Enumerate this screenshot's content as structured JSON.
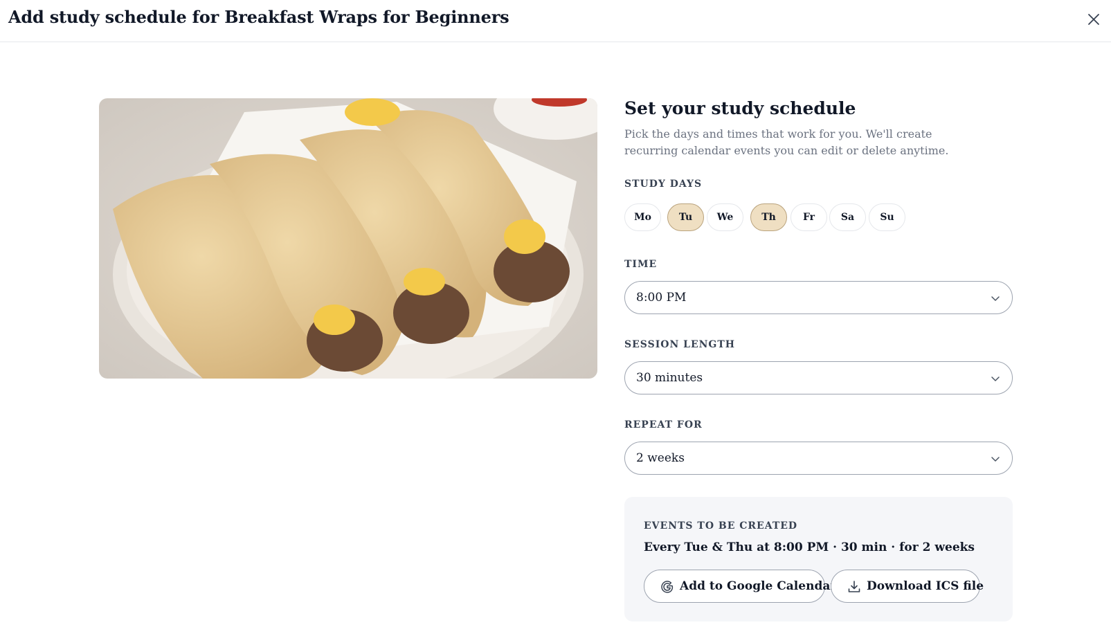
{
  "header": {
    "title": "Add study schedule for Breakfast Wraps for Beginners"
  },
  "panel": {
    "title": "Set your study schedule",
    "description": "Pick the days and times that work for you. We'll create recurring calendar events you can edit or delete anytime."
  },
  "study_days": {
    "label": "STUDY DAYS",
    "days": [
      {
        "label": "Mo",
        "selected": false
      },
      {
        "label": "Tu",
        "selected": true
      },
      {
        "label": "We",
        "selected": false
      },
      {
        "label": "Th",
        "selected": true
      },
      {
        "label": "Fr",
        "selected": false
      },
      {
        "label": "Sa",
        "selected": false
      },
      {
        "label": "Su",
        "selected": false
      }
    ]
  },
  "time": {
    "label": "TIME",
    "value": "8:00 PM"
  },
  "session_length": {
    "label": "SESSION LENGTH",
    "value": "30 minutes"
  },
  "repeat_for": {
    "label": "REPEAT FOR",
    "value": "2 weeks"
  },
  "events": {
    "label": "EVENTS TO BE CREATED",
    "summary": "Every Tue & Thu at 8:00 PM · 30 min · for 2 weeks",
    "google_button": "Add to Google Calendar",
    "ics_button": "Download ICS file"
  },
  "icons": {
    "close": "close-icon",
    "chevron": "chevron-down-icon",
    "google": "google-icon",
    "download": "download-icon"
  },
  "colors": {
    "selected_day_bg": "#efdfc2",
    "selected_day_border": "#b9a27c",
    "events_bg": "#f5f6f9"
  }
}
